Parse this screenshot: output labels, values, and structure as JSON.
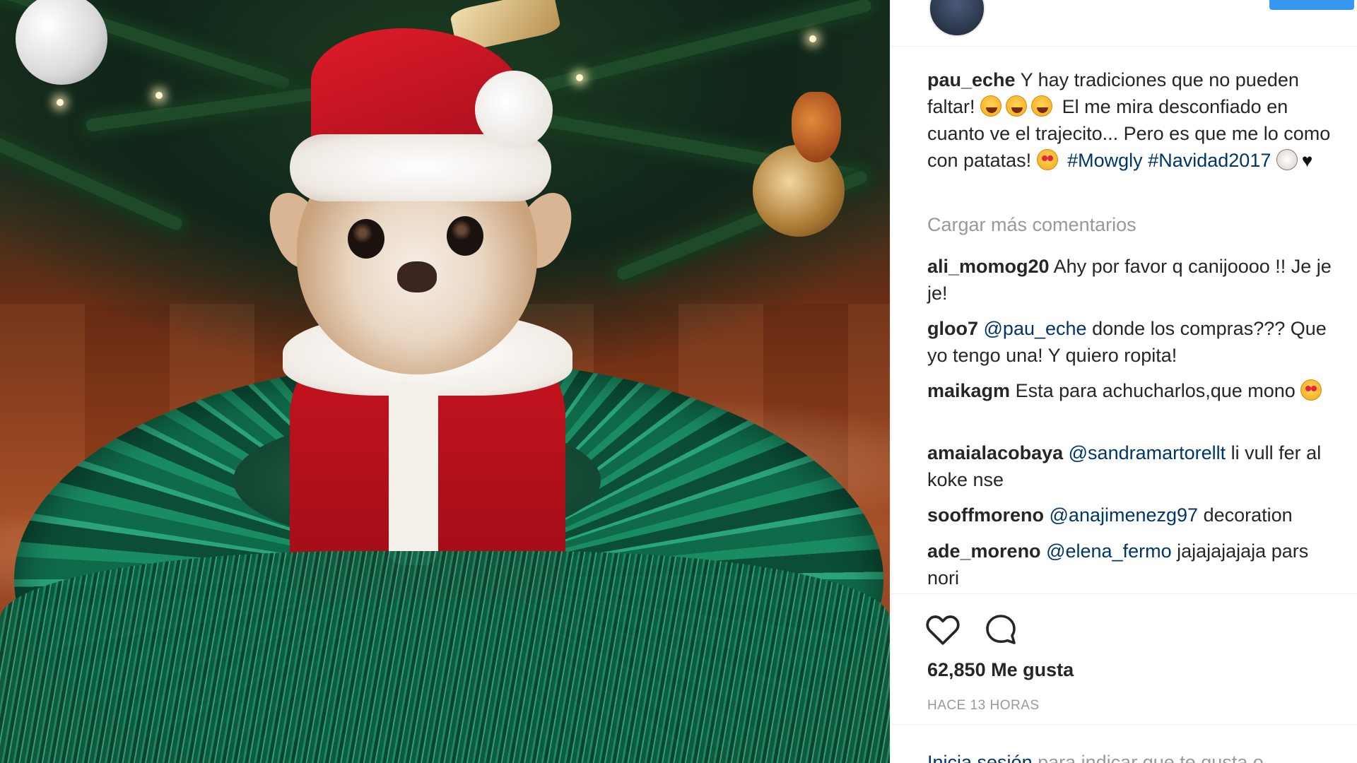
{
  "post": {
    "username": "pau_eche",
    "caption_parts": {
      "text1": "Y hay tradiciones que no pueden faltar!",
      "text2": "El me mira desconfiado en cuanto ve el trajecito... Pero es que me lo como con patatas!",
      "hashtag1": "#Mowgly",
      "hashtag2": "#Navidad2017"
    }
  },
  "load_more": "Cargar más comentarios",
  "comments": [
    {
      "user": "ali_momog20",
      "mention": "",
      "text": "Ahy por favor q canijoooo !! Je je je!"
    },
    {
      "user": "gloo7",
      "mention": "@pau_eche",
      "text": "donde los compras??? Que yo tengo una! Y quiero ropita!"
    },
    {
      "user": "maikagm",
      "mention": "",
      "text": "Esta para achucharlos,que mono"
    },
    {
      "user": "amaialacobaya",
      "mention": "@sandramartorellt",
      "text": "li vull fer al koke nse"
    },
    {
      "user": "sooffmoreno",
      "mention": "@anajimenezg97",
      "text": "decoration"
    },
    {
      "user": "ade_moreno",
      "mention": "@elena_fermo",
      "text": "jajajajajaja pars nori"
    }
  ],
  "likes": "62,850 Me gusta",
  "time": "HACE 13 HORAS",
  "login": {
    "link": "Inicia sesión",
    "text": "para indicar que te gusta o"
  },
  "icons": {
    "like": "heart-icon",
    "comment": "comment-bubble-icon"
  },
  "colors": {
    "link": "#003569",
    "muted": "#999999",
    "follow": "#3897f0"
  }
}
